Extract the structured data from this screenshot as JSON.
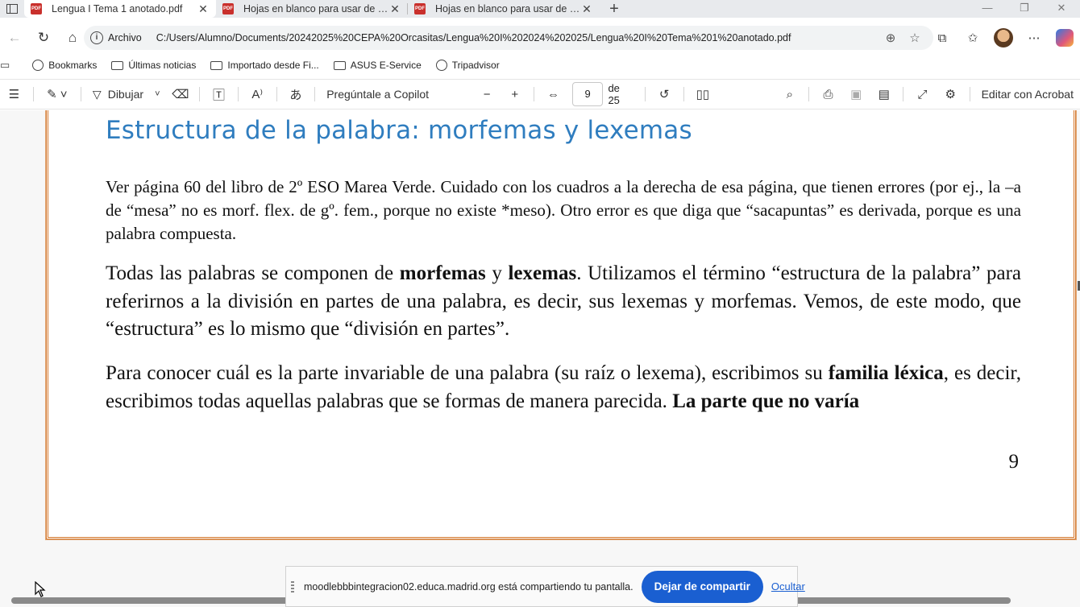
{
  "tabs": [
    {
      "label": "Lengua I Tema 1 anotado.pdf",
      "active": true
    },
    {
      "label": "Hojas en blanco para usar de pizarra",
      "active": false
    },
    {
      "label": "Hojas en blanco para usar de pizarra",
      "active": false
    }
  ],
  "address": {
    "scheme": "Archivo",
    "url": "C:/Users/Alumno/Documents/20242025%20CEPA%20Orcasitas/Lengua%20I%202024%202025/Lengua%20I%20Tema%201%20anotado.pdf"
  },
  "bookmarks": [
    {
      "label": "Bookmarks",
      "icon": "globe-icon"
    },
    {
      "label": "Últimas noticias",
      "icon": "folder-icon"
    },
    {
      "label": "Importado desde Fi...",
      "icon": "folder-icon"
    },
    {
      "label": "ASUS E-Service",
      "icon": "folder-icon"
    },
    {
      "label": "Tripadvisor",
      "icon": "globe-icon"
    }
  ],
  "pdf_toolbar": {
    "draw_label": "Dibujar",
    "copilot_label": "Pregúntale a Copilot",
    "page_current": "9",
    "page_total": "de 25",
    "edit_label": "Editar con Acrobat"
  },
  "document": {
    "title": "Estructura de la palabra: morfemas y lexemas",
    "p1": "Ver página 60 del libro de 2º ESO Marea Verde. Cuidado con los cuadros a la derecha de esa página, que tienen errores (por ej., la –a de “mesa” no es morf. flex. de gº. fem., porque no existe *meso). Otro error es que diga que “sacapuntas” es derivada, porque es una palabra compuesta.",
    "p2": {
      "a": "Todas las palabras se componen de ",
      "b1": "morfemas",
      "c": " y ",
      "b2": "lexemas",
      "d": ". Utilizamos el término “estructura de la palabra” para referirnos a la división en partes de una palabra, es decir, sus lexemas y morfemas. Vemos, de este modo, que “estructura” es lo mismo que “división en partes”."
    },
    "p3": {
      "a": "Para conocer cuál es la parte invariable de una palabra (su raíz o lexema), escribimos su ",
      "b1": "familia léxica",
      "c": ", es decir, escribimos todas aquellas palabras que se formas de manera parecida. ",
      "b2": "La parte que no varía"
    },
    "page_number": "9"
  },
  "share_bar": {
    "text": "moodlebbbintegracion02.educa.madrid.org está compartiendo tu pantalla.",
    "stop_label": "Dejar de compartir",
    "hide_label": "Ocultar"
  },
  "colors": {
    "title_blue": "#2f7dbf",
    "page_border": "#d4772c",
    "share_button": "#1a5fd1"
  }
}
